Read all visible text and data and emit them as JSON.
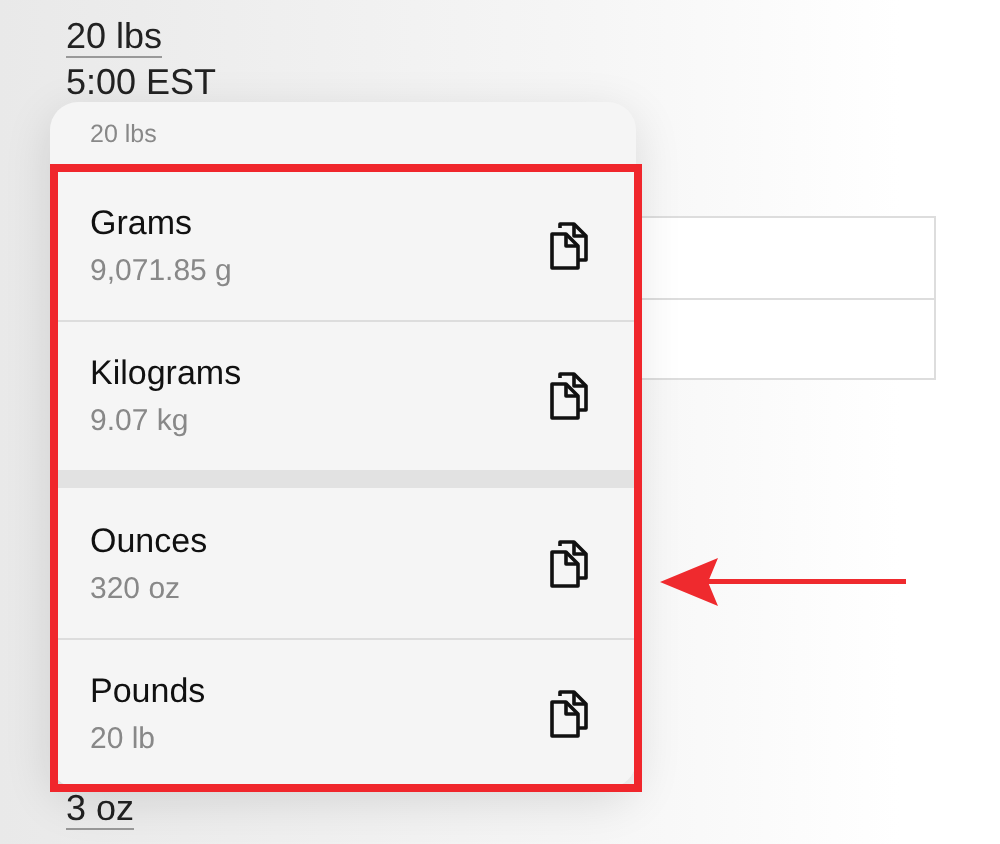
{
  "background": {
    "weight": "20 lbs",
    "time": "5:00 EST",
    "footer_value": "3 oz"
  },
  "menu": {
    "header": "20 lbs",
    "sections": [
      {
        "items": [
          {
            "name": "Grams",
            "value": "9,071.85 g"
          },
          {
            "name": "Kilograms",
            "value": "9.07 kg"
          }
        ]
      },
      {
        "items": [
          {
            "name": "Ounces",
            "value": "320 oz"
          },
          {
            "name": "Pounds",
            "value": "20 lb"
          }
        ]
      }
    ]
  }
}
